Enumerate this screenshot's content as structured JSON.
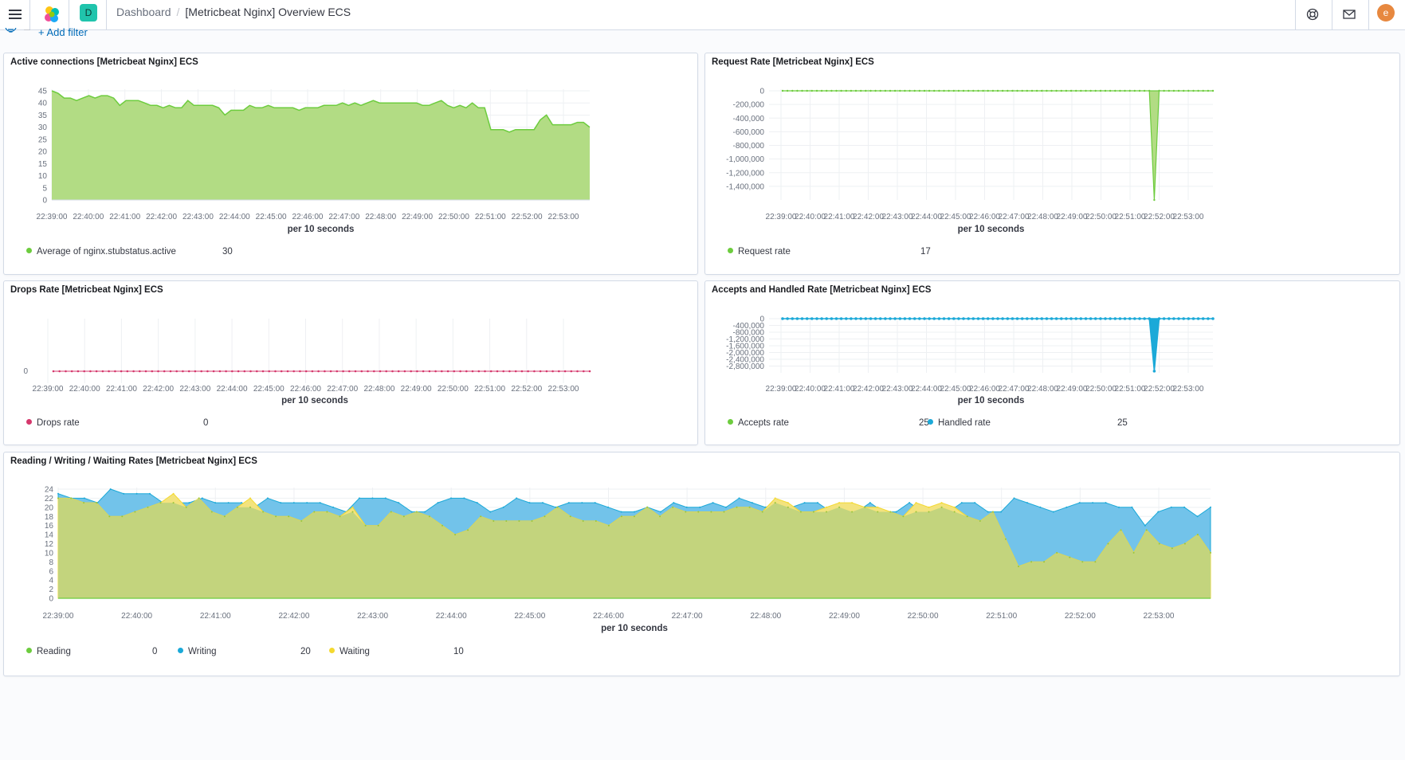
{
  "header": {
    "space_initial": "D",
    "breadcrumb_root": "Dashboard",
    "breadcrumb_current": "[Metricbeat Nginx] Overview ECS",
    "user_initial": "e"
  },
  "filterbar": {
    "add_filter_label": "+ Add filter"
  },
  "colors": {
    "green": "#6dcc3e",
    "green_fill": "#b2dc84",
    "pink": "#d5386c",
    "blue": "#1ba9d8",
    "blue_fill": "#72c3ea",
    "yellow": "#f4d92f",
    "yellow_fill": "#f3e37e",
    "olive_fill": "#c3d47d"
  },
  "icons": [
    "menu-icon",
    "elastic-logo-icon",
    "help-icon",
    "mail-icon",
    "filter-icon"
  ],
  "panels": {
    "active": {
      "title": "Active connections [Metricbeat Nginx] ECS",
      "xlabel": "per 10 seconds",
      "legend": [
        {
          "label": "Average of nginx.stubstatus.active",
          "value": "30"
        }
      ]
    },
    "request": {
      "title": "Request Rate [Metricbeat Nginx] ECS",
      "xlabel": "per 10 seconds",
      "legend": [
        {
          "label": "Request rate",
          "value": "17"
        }
      ]
    },
    "drops": {
      "title": "Drops Rate [Metricbeat Nginx] ECS",
      "xlabel": "per 10 seconds",
      "legend": [
        {
          "label": "Drops rate",
          "value": "0"
        }
      ]
    },
    "accepts": {
      "title": "Accepts and Handled Rate [Metricbeat Nginx] ECS",
      "xlabel": "per 10 seconds",
      "legend": [
        {
          "label": "Accepts rate",
          "value": "25"
        },
        {
          "label": "Handled rate",
          "value": "25"
        }
      ]
    },
    "rww": {
      "title": "Reading / Writing / Waiting Rates [Metricbeat Nginx] ECS",
      "xlabel": "per 10 seconds",
      "legend": [
        {
          "label": "Reading",
          "value": "0"
        },
        {
          "label": "Writing",
          "value": "20"
        },
        {
          "label": "Waiting",
          "value": "10"
        }
      ]
    }
  },
  "chart_data": [
    {
      "id": "active",
      "type": "area",
      "title": "Active connections [Metricbeat Nginx] ECS",
      "xlabel": "per 10 seconds",
      "x_ticks": [
        "22:39:00",
        "22:40:00",
        "22:41:00",
        "22:42:00",
        "22:43:00",
        "22:44:00",
        "22:45:00",
        "22:46:00",
        "22:47:00",
        "22:48:00",
        "22:49:00",
        "22:50:00",
        "22:51:00",
        "22:52:00",
        "22:53:00"
      ],
      "ylim": [
        0,
        45
      ],
      "y_ticks": [
        0,
        5,
        10,
        15,
        20,
        25,
        30,
        35,
        40,
        45
      ],
      "series": [
        {
          "name": "Average of nginx.stubstatus.active",
          "values": [
            45,
            44,
            42,
            42,
            41,
            42,
            43,
            42,
            43,
            43,
            42,
            39,
            41,
            41,
            41,
            40,
            39,
            39,
            38,
            39,
            38,
            38,
            41,
            39,
            39,
            39,
            39,
            38,
            35,
            37,
            37,
            37,
            39,
            38,
            38,
            39,
            38,
            38,
            38,
            38,
            37,
            38,
            38,
            38,
            39,
            39,
            39,
            40,
            39,
            40,
            39,
            40,
            41,
            40,
            40,
            40,
            40,
            40,
            40,
            40,
            39,
            39,
            40,
            41,
            39,
            38,
            39,
            38,
            40,
            38,
            38,
            29,
            29,
            29,
            28,
            29,
            29,
            29,
            29,
            33,
            35,
            31,
            31,
            31,
            31,
            32,
            32,
            30
          ]
        }
      ]
    },
    {
      "id": "request",
      "type": "area",
      "title": "Request Rate [Metricbeat Nginx] ECS",
      "xlabel": "per 10 seconds",
      "x_ticks": [
        "22:39:00",
        "22:40:00",
        "22:41:00",
        "22:42:00",
        "22:43:00",
        "22:44:00",
        "22:45:00",
        "22:46:00",
        "22:47:00",
        "22:48:00",
        "22:49:00",
        "22:50:00",
        "22:51:00",
        "22:52:00",
        "22:53:00"
      ],
      "ylim": [
        -1600000,
        0
      ],
      "y_ticks": [
        0,
        -200000,
        -400000,
        -600000,
        -800000,
        -1000000,
        -1200000,
        -1400000
      ],
      "series": [
        {
          "name": "Request rate",
          "note_values": "approximately 17 everywhere except a single spike down to about -1,600,000 at 22:51:00",
          "spike_value": -1600000,
          "baseline": 17
        }
      ]
    },
    {
      "id": "drops",
      "type": "line",
      "title": "Drops Rate [Metricbeat Nginx] ECS",
      "xlabel": "per 10 seconds",
      "x_ticks": [
        "22:39:00",
        "22:40:00",
        "22:41:00",
        "22:42:00",
        "22:43:00",
        "22:44:00",
        "22:45:00",
        "22:46:00",
        "22:47:00",
        "22:48:00",
        "22:49:00",
        "22:50:00",
        "22:51:00",
        "22:52:00",
        "22:53:00"
      ],
      "ylim": [
        0,
        0
      ],
      "y_ticks": [
        0
      ],
      "series": [
        {
          "name": "Drops rate",
          "baseline": 0
        }
      ]
    },
    {
      "id": "accepts",
      "type": "area",
      "title": "Accepts and Handled Rate [Metricbeat Nginx] ECS",
      "xlabel": "per 10 seconds",
      "x_ticks": [
        "22:39:00",
        "22:40:00",
        "22:41:00",
        "22:42:00",
        "22:43:00",
        "22:44:00",
        "22:45:00",
        "22:46:00",
        "22:47:00",
        "22:48:00",
        "22:49:00",
        "22:50:00",
        "22:51:00",
        "22:52:00",
        "22:53:00"
      ],
      "ylim": [
        -3200000,
        0
      ],
      "y_ticks": [
        0,
        -400000,
        -800000,
        -1200000,
        -1600000,
        -2000000,
        -2400000,
        -2800000
      ],
      "series": [
        {
          "name": "Accepts rate",
          "baseline": 25,
          "spike_value": -3100000
        },
        {
          "name": "Handled rate",
          "baseline": 25,
          "spike_value": -3100000
        }
      ]
    },
    {
      "id": "rww",
      "type": "area",
      "title": "Reading / Writing / Waiting Rates [Metricbeat Nginx] ECS",
      "xlabel": "per 10 seconds",
      "x_ticks": [
        "22:39:00",
        "22:40:00",
        "22:41:00",
        "22:42:00",
        "22:43:00",
        "22:44:00",
        "22:45:00",
        "22:46:00",
        "22:47:00",
        "22:48:00",
        "22:49:00",
        "22:50:00",
        "22:51:00",
        "22:52:00",
        "22:53:00"
      ],
      "ylim": [
        0,
        24
      ],
      "y_ticks": [
        0,
        2,
        4,
        6,
        8,
        10,
        12,
        14,
        16,
        18,
        20,
        22,
        24
      ],
      "series": [
        {
          "name": "Reading",
          "values": [
            0
          ]
        },
        {
          "name": "Writing",
          "values": [
            23,
            22,
            22,
            21,
            24,
            23,
            23,
            23,
            21,
            21,
            21,
            22,
            21,
            21,
            21,
            20,
            22,
            21,
            21,
            21,
            21,
            20,
            19,
            22,
            22,
            22,
            21,
            19,
            19,
            21,
            22,
            22,
            21,
            19,
            20,
            22,
            21,
            21,
            20,
            21,
            21,
            21,
            20,
            19,
            19,
            20,
            19,
            21,
            20,
            20,
            21,
            20,
            22,
            21,
            20,
            21,
            20,
            21,
            21,
            19,
            20,
            19,
            21,
            19,
            19,
            21,
            19,
            20,
            19,
            21,
            21,
            19,
            19,
            22,
            21,
            20,
            19,
            20,
            21,
            21,
            21,
            20,
            20,
            16,
            19,
            20,
            20,
            18,
            20
          ]
        },
        {
          "name": "Waiting",
          "values": [
            22,
            22,
            21,
            21,
            18,
            18,
            19,
            20,
            21,
            23,
            20,
            22,
            19,
            18,
            20,
            22,
            19,
            18,
            18,
            17,
            19,
            19,
            18,
            20,
            16,
            16,
            19,
            18,
            19,
            18,
            16,
            14,
            15,
            18,
            17,
            17,
            17,
            17,
            18,
            20,
            18,
            17,
            17,
            16,
            18,
            18,
            20,
            18,
            20,
            19,
            19,
            19,
            19,
            20,
            20,
            19,
            22,
            21,
            19,
            19,
            20,
            21,
            21,
            20,
            20,
            19,
            18,
            21,
            20,
            21,
            20,
            18,
            17,
            19,
            13,
            7,
            8,
            8,
            10,
            9,
            8,
            8,
            12,
            15,
            10,
            15,
            12,
            11,
            12,
            14,
            10
          ]
        }
      ]
    }
  ]
}
